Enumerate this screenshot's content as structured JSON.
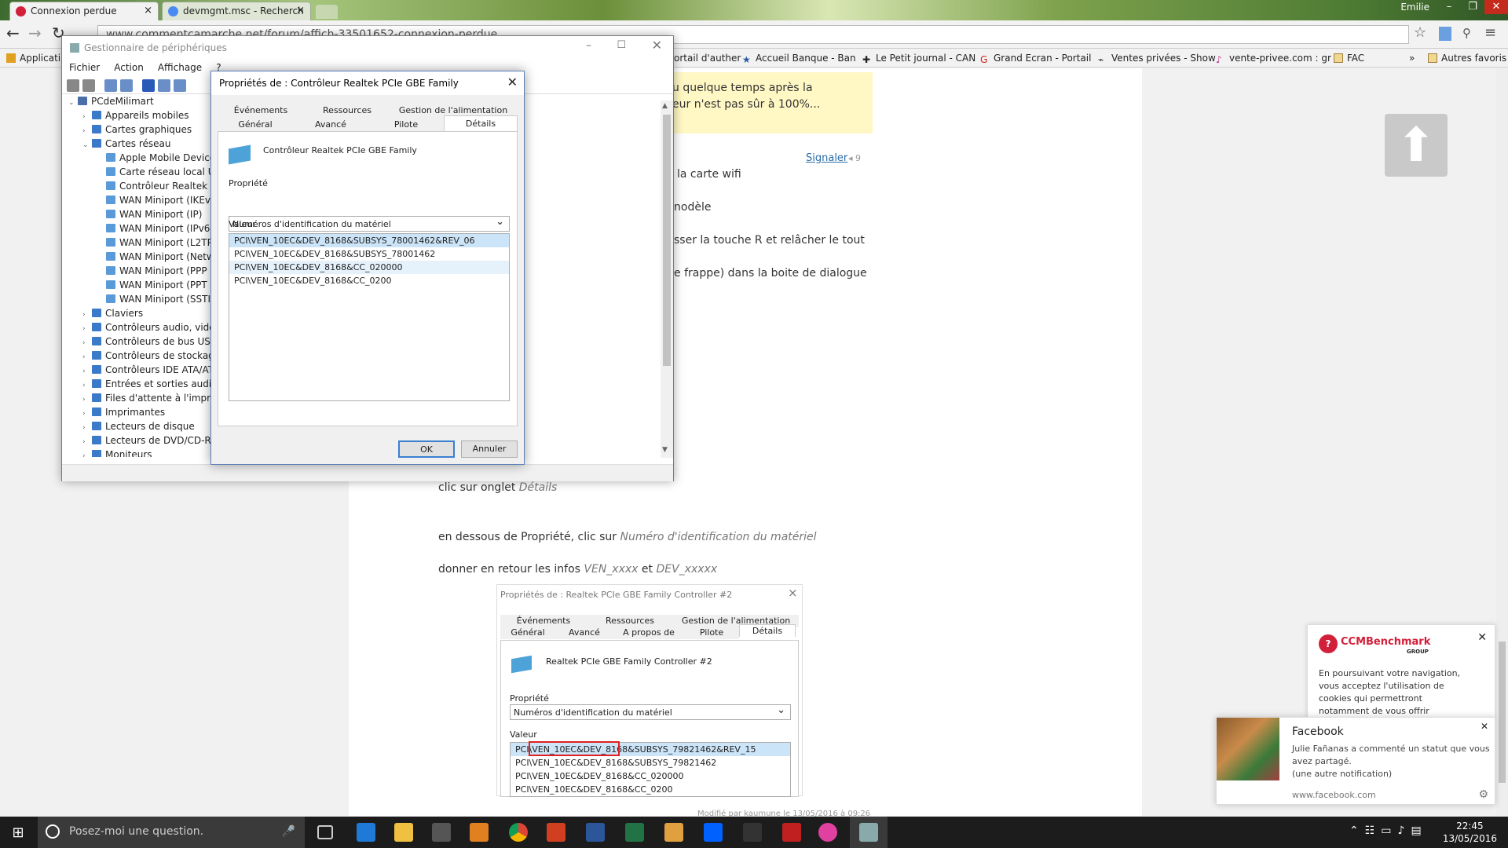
{
  "browser": {
    "tabs": [
      {
        "label": "Connexion perdue",
        "active": true
      },
      {
        "label": "devmgmt.msc - Recherch",
        "active": false
      }
    ],
    "user": "Emilie",
    "url": "www.commentcamarche.net/forum/affich-33501652-connexion-perdue",
    "bookmarks": [
      "Applicati",
      "ortail d'auther",
      "Accueil Banque - Ban",
      "Le Petit journal - CAN",
      "Grand Ecran - Portail",
      "Ventes privées - Show",
      "vente-privee.com : gr",
      "FAC",
      "»",
      "Autres favoris"
    ]
  },
  "page": {
    "yellow_lines": [
      "u quelque temps après la",
      "eur n'est pas sûr à 100%..."
    ],
    "signaler": "Signaler",
    "vote": "9",
    "steps": [
      "la carte wifi",
      "nodèle",
      "sser la touche R et relâcher le tout",
      "e frappe) dans la boite de dialogue"
    ],
    "p1_pre": "clic sur onglet ",
    "p1_em": "Détails",
    "p2_pre": "en dessous de Propriété, clic sur ",
    "p2_em": "Numéro d'identification du matériel",
    "p3_pre": "donner en retour les infos ",
    "p3_em1": "VEN_xxxx",
    "p3_mid": " et ",
    "p3_em2": "DEV_xxxxx",
    "modified": "Modifié par kaumune le 13/05/2016 à 09:26"
  },
  "devmgr": {
    "title": "Gestionnaire de périphériques",
    "menu": [
      "Fichier",
      "Action",
      "Affichage",
      "?"
    ],
    "tree": [
      {
        "label": "PCdeMilimart",
        "level": 0,
        "exp": "v"
      },
      {
        "label": "Appareils mobiles",
        "level": 1,
        "exp": ">"
      },
      {
        "label": "Cartes graphiques",
        "level": 1,
        "exp": ">"
      },
      {
        "label": "Cartes réseau",
        "level": 1,
        "exp": "v"
      },
      {
        "label": "Apple Mobile Device",
        "level": 2,
        "exp": ""
      },
      {
        "label": "Carte réseau local Us",
        "level": 2,
        "exp": ""
      },
      {
        "label": "Contrôleur Realtek P",
        "level": 2,
        "exp": ""
      },
      {
        "label": "WAN Miniport (IKEv",
        "level": 2,
        "exp": ""
      },
      {
        "label": "WAN Miniport (IP)",
        "level": 2,
        "exp": ""
      },
      {
        "label": "WAN Miniport (IPv6",
        "level": 2,
        "exp": ""
      },
      {
        "label": "WAN Miniport (L2TP",
        "level": 2,
        "exp": ""
      },
      {
        "label": "WAN Miniport (Netw",
        "level": 2,
        "exp": ""
      },
      {
        "label": "WAN Miniport (PPP",
        "level": 2,
        "exp": ""
      },
      {
        "label": "WAN Miniport (PPT",
        "level": 2,
        "exp": ""
      },
      {
        "label": "WAN Miniport (SSTI",
        "level": 2,
        "exp": ""
      },
      {
        "label": "Claviers",
        "level": 1,
        "exp": ">"
      },
      {
        "label": "Contrôleurs audio, vidé",
        "level": 1,
        "exp": ">"
      },
      {
        "label": "Contrôleurs de bus USB",
        "level": 1,
        "exp": ">"
      },
      {
        "label": "Contrôleurs de stockage",
        "level": 1,
        "exp": ">"
      },
      {
        "label": "Contrôleurs IDE ATA/AT",
        "level": 1,
        "exp": ">"
      },
      {
        "label": "Entrées et sorties audio",
        "level": 1,
        "exp": ">"
      },
      {
        "label": "Files d'attente à l'impre",
        "level": 1,
        "exp": ">"
      },
      {
        "label": "Imprimantes",
        "level": 1,
        "exp": ">"
      },
      {
        "label": "Lecteurs de disque",
        "level": 1,
        "exp": ">"
      },
      {
        "label": "Lecteurs de DVD/CD-RO",
        "level": 1,
        "exp": ">"
      },
      {
        "label": "Moniteurs",
        "level": 1,
        "exp": ">"
      }
    ]
  },
  "props": {
    "title": "Propriétés de : Contrôleur Realtek PCIe GBE Family",
    "tabs_row1": [
      "Événements",
      "Ressources",
      "Gestion de l'alimentation"
    ],
    "tabs_row2": [
      "Général",
      "Avancé",
      "Pilote",
      "Détails"
    ],
    "device": "Contrôleur Realtek PCIe GBE Family",
    "property_label": "Propriété",
    "property_value": "Numéros d'identification du matériel",
    "value_label": "Valeur",
    "values": [
      "PCI\\VEN_10EC&DEV_8168&SUBSYS_78001462&REV_06",
      "PCI\\VEN_10EC&DEV_8168&SUBSYS_78001462",
      "PCI\\VEN_10EC&DEV_8168&CC_020000",
      "PCI\\VEN_10EC&DEV_8168&CC_0200"
    ],
    "ok": "OK",
    "cancel": "Annuler"
  },
  "embedded": {
    "title": "Propriétés de : Realtek PCIe GBE Family Controller #2",
    "tabs_row1": [
      "Événements",
      "Ressources",
      "Gestion de l'alimentation"
    ],
    "tabs_row2": [
      "Général",
      "Avancé",
      "A propos de",
      "Pilote",
      "Détails"
    ],
    "device": "Realtek PCIe GBE Family Controller #2",
    "property_label": "Propriété",
    "property_value": "Numéros d'identification du matériel",
    "value_label": "Valeur",
    "values": [
      "PCI\\VEN_10EC&DEV_8168&SUBSYS_79821462&REV_15",
      "PCI\\VEN_10EC&DEV_8168&SUBSYS_79821462",
      "PCI\\VEN_10EC&DEV_8168&CC_020000",
      "PCI\\VEN_10EC&DEV_8168&CC_0200"
    ]
  },
  "ccm": {
    "brand": "CCMBenchmark",
    "group": "GROUP",
    "text": [
      "En poursuivant votre navigation,",
      "vous acceptez l'utilisation de",
      "cookies qui permettront",
      "notamment de vous offrir"
    ]
  },
  "facebook": {
    "title": "Facebook",
    "body": [
      "Julie Fañanas a commenté un statut que vous",
      "avez partagé.",
      "(une autre notification)"
    ],
    "link": "www.facebook.com"
  },
  "taskbar": {
    "search": "Posez-moi une question.",
    "time": "22:45",
    "date": "13/05/2016"
  },
  "colors": {
    "accent": "#3c7fd1",
    "highlight_red": "#e02020",
    "ccm_red": "#d3203a"
  }
}
